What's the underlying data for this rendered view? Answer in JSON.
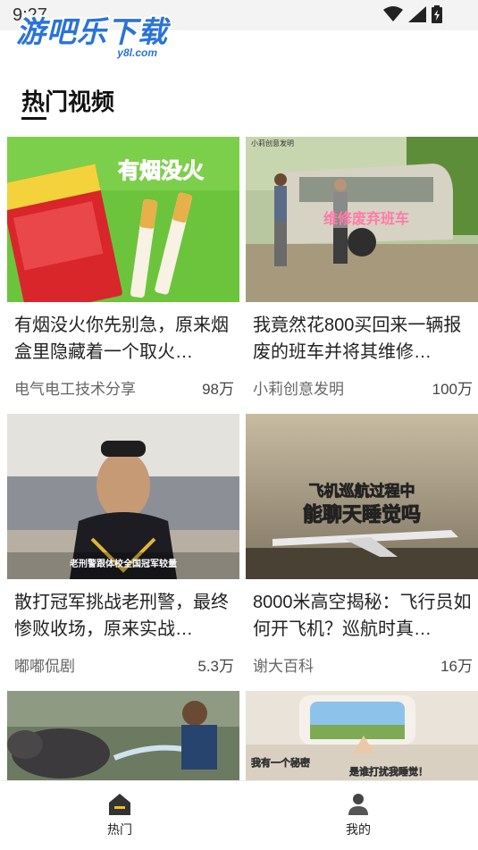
{
  "status_bar": {
    "time": "9:27"
  },
  "watermark": {
    "main": "游吧乐下载",
    "sub": "y8l.com"
  },
  "section": {
    "title": "热门视频"
  },
  "videos": [
    {
      "overlay": "有烟没火",
      "title": "有烟没火你先别急，原来烟盒里隐藏着一个取火…",
      "author": "电气电工技术分享",
      "views": "98万"
    },
    {
      "overlay": "维修废弃班车",
      "title": "我竟然花800买回来一辆报废的班车并将其维修…",
      "author": "小莉创意发明",
      "views": "100万"
    },
    {
      "overlay": "老刑警跟体校全国冠军较量",
      "title": "散打冠军挑战老刑警，最终惨败收场，原来实战…",
      "author": "嘟嘟侃剧",
      "views": "5.3万"
    },
    {
      "overlay_line1": "飞机巡航过程中",
      "overlay_line2": "能聊天睡觉吗",
      "title": "8000米高空揭秘：飞行员如何开飞机？巡航时真…",
      "author": "谢大百科",
      "views": "16万"
    },
    {
      "overlay": ""
    },
    {
      "overlay_left": "我有一个秘密",
      "overlay_right": "是谁打扰我睡觉！"
    }
  ],
  "nav": {
    "hot_label": "热门",
    "mine_label": "我的"
  },
  "colors": {
    "accent": "#2a73d9",
    "nav_icon": "#333333"
  },
  "icons": [
    "wifi-icon",
    "signal-icon",
    "battery-icon",
    "home-icon",
    "user-icon"
  ]
}
